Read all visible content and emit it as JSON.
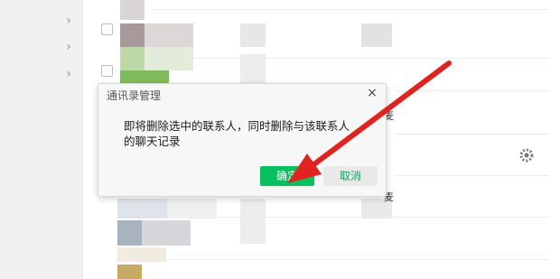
{
  "dialog": {
    "title": "通讯录管理",
    "close_label": "×",
    "message_line1": "即将删除选中的联系人，同时删除与该联系人",
    "message_line2": "的聊天记录",
    "ok_label": "确定",
    "cancel_label": "取消"
  },
  "partial_text": {
    "fragment_a": "麦",
    "fragment_b": "麦"
  },
  "colors": {
    "accent": "#07c160",
    "arrow": "#e3221f"
  },
  "icons": [
    "chevron-right-icon",
    "close-icon",
    "settings-icon"
  ]
}
